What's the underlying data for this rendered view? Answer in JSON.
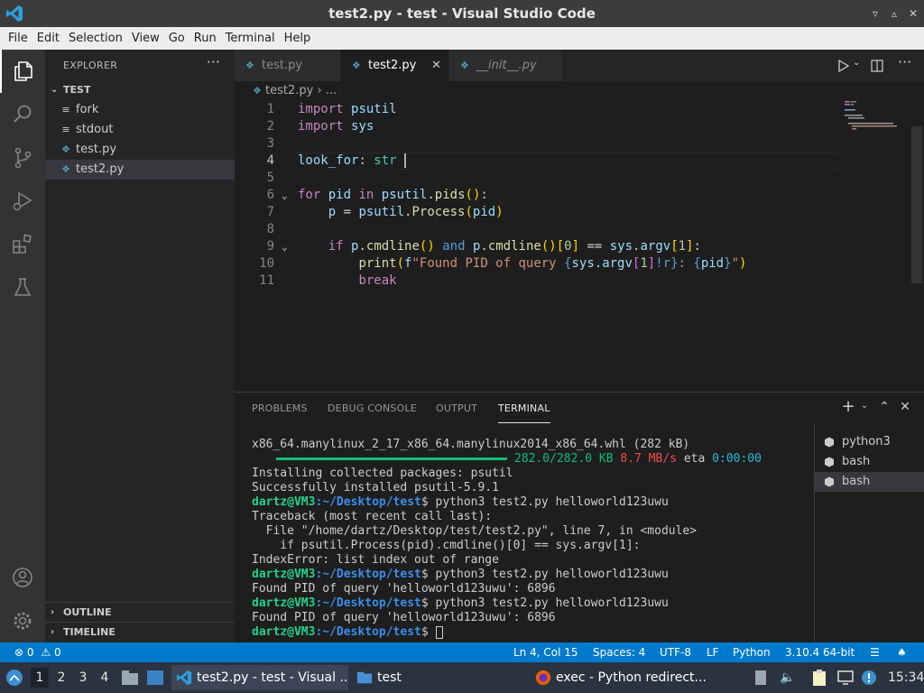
{
  "window": {
    "title": "test2.py - test - Visual Studio Code"
  },
  "menu": [
    "File",
    "Edit",
    "Selection",
    "View",
    "Go",
    "Run",
    "Terminal",
    "Help"
  ],
  "sidebar": {
    "title": "EXPLORER",
    "more": "···",
    "folder": "TEST",
    "files": [
      {
        "name": "fork",
        "icon": "lines-icon"
      },
      {
        "name": "stdout",
        "icon": "lines-icon"
      },
      {
        "name": "test.py",
        "icon": "python-icon"
      },
      {
        "name": "test2.py",
        "icon": "python-icon",
        "selected": true
      }
    ],
    "outline": "OUTLINE",
    "timeline": "TIMELINE"
  },
  "tabs": [
    {
      "label": "test.py",
      "active": false
    },
    {
      "label": "test2.py",
      "active": true,
      "close": "✕"
    },
    {
      "label": "__init__.py",
      "active": false,
      "italic": true
    }
  ],
  "breadcrumb": {
    "file": "test2.py",
    "rest": "› ..."
  },
  "editor": {
    "line_numbers": [
      "1",
      "2",
      "3",
      "4",
      "5",
      "6",
      "7",
      "8",
      "9",
      "10",
      "11"
    ],
    "current_line": 4,
    "lines": [
      "import psutil",
      "import sys",
      "",
      "look_for: str ",
      "",
      "for pid in psutil.pids():",
      "    p = psutil.Process(pid)",
      "",
      "    if p.cmdline() and p.cmdline()[0] == sys.argv[1]:",
      "        print(f\"Found PID of query {sys.argv[1]!r}: {pid}\")",
      "        break"
    ]
  },
  "panel": {
    "tabs": [
      "PROBLEMS",
      "DEBUG CONSOLE",
      "OUTPUT",
      "TERMINAL"
    ],
    "active_tab": "TERMINAL",
    "terminals": [
      "python3",
      "bash",
      "bash"
    ],
    "progress_text": "282.0/282.0 KB",
    "speed": "8.7 MB/s",
    "eta_label": "eta",
    "eta": "0:00:00",
    "user_host": "dartz@VM3",
    "path": ":~/Desktop/test",
    "prompt_suffix": "$ ",
    "command": "python3 test2.py helloworld123uwu",
    "lines": {
      "wheel": "x86_64.manylinux_2_17_x86_64.manylinux2014_x86_64.whl (282 kB)",
      "installing": "Installing collected packages: psutil",
      "installed": "Successfully installed psutil-5.9.1",
      "traceback": "Traceback (most recent call last):",
      "file": "  File \"/home/dartz/Desktop/test/test2.py\", line 7, in <module>",
      "code": "    if psutil.Process(pid).cmdline()[0] == sys.argv[1]:",
      "error": "IndexError: list index out of range",
      "found1": "Found PID of query 'helloworld123uwu': 6896",
      "found2": "Found PID of query 'helloworld123uwu': 6896"
    }
  },
  "statusbar": {
    "errors": "0",
    "warnings": "0",
    "position": "Ln 4, Col 15",
    "spaces": "Spaces: 4",
    "encoding": "UTF-8",
    "eol": "LF",
    "language": "Python",
    "interpreter": "3.10.4 64-bit"
  },
  "taskbar": {
    "workspaces": [
      "1",
      "2",
      "3",
      "4"
    ],
    "windows": [
      {
        "label": "test2.py - test - Visual ...",
        "icon": "vscode-icon",
        "active": true
      },
      {
        "label": "test",
        "icon": "folder-icon"
      },
      {
        "label": "exec - Python redirect...",
        "icon": "firefox-icon"
      }
    ],
    "clock": "15:34"
  },
  "colors": {
    "accent": "#007acc",
    "titlebar": "#3c3c3c",
    "editor_bg": "#1e1e1e"
  }
}
